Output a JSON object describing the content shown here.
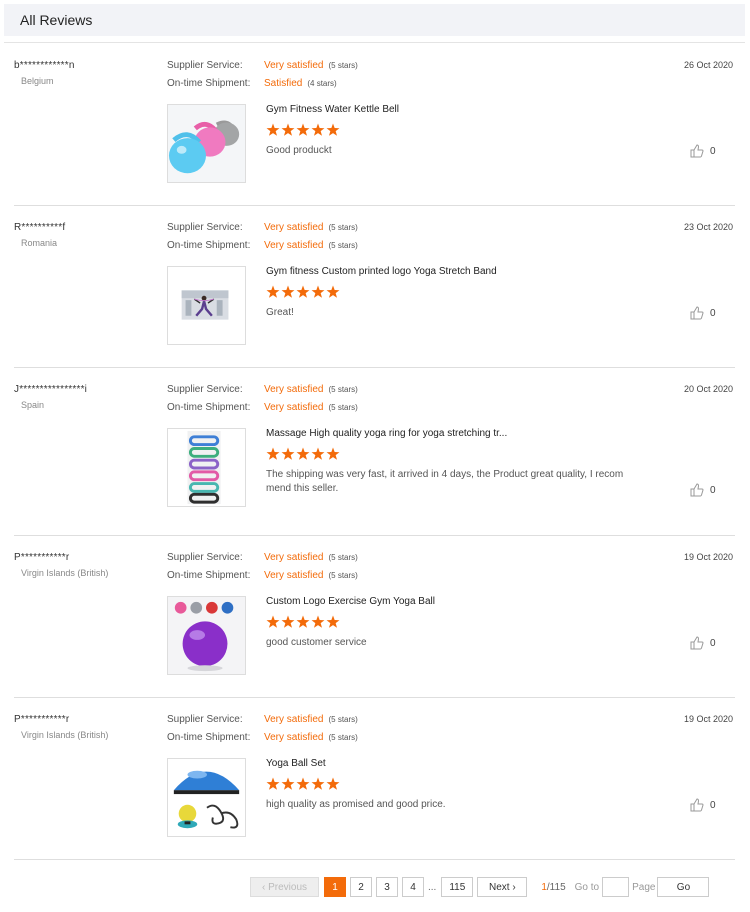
{
  "header": {
    "title": "All Reviews"
  },
  "labels": {
    "supplier_service": "Supplier Service:",
    "on_time_shipment": "On-time Shipment:"
  },
  "reviews": [
    {
      "reviewer": "b************n",
      "country": "Belgium",
      "date": "26 Oct 2020",
      "supplier_service": {
        "value": "Very satisfied",
        "stars": "(5 stars)"
      },
      "on_time_shipment": {
        "value": "Satisfied",
        "stars": "(4 stars)"
      },
      "product": "Gym Fitness Water Kettle Bell",
      "rating": 5,
      "comment": "Good produckt",
      "likes": "0",
      "image_icon": "kettlebell-product-image"
    },
    {
      "reviewer": "R**********f",
      "country": "Romania",
      "date": "23 Oct 2020",
      "supplier_service": {
        "value": "Very satisfied",
        "stars": "(5 stars)"
      },
      "on_time_shipment": {
        "value": "Very satisfied",
        "stars": "(5 stars)"
      },
      "product": "Gym fitness Custom printed logo Yoga Stretch Band",
      "rating": 5,
      "comment": "Great!",
      "likes": "0",
      "image_icon": "yoga-band-product-image"
    },
    {
      "reviewer": "J****************i",
      "country": "Spain",
      "date": "20 Oct 2020",
      "supplier_service": {
        "value": "Very satisfied",
        "stars": "(5 stars)"
      },
      "on_time_shipment": {
        "value": "Very satisfied",
        "stars": "(5 stars)"
      },
      "product": "Massage High quality yoga ring for yoga stretching tr...",
      "rating": 5,
      "comment": "The shipping was very fast, it arrived in 4 days, the Product great quality, I recom mend this seller.",
      "likes": "0",
      "image_icon": "yoga-ring-product-image"
    },
    {
      "reviewer": "P***********r",
      "country": "Virgin Islands (British)",
      "date": "19 Oct 2020",
      "supplier_service": {
        "value": "Very satisfied",
        "stars": "(5 stars)"
      },
      "on_time_shipment": {
        "value": "Very satisfied",
        "stars": "(5 stars)"
      },
      "product": "Custom Logo Exercise Gym Yoga Ball",
      "rating": 5,
      "comment": "good customer service",
      "likes": "0",
      "image_icon": "yoga-ball-product-image"
    },
    {
      "reviewer": "P***********r",
      "country": "Virgin Islands (British)",
      "date": "19 Oct 2020",
      "supplier_service": {
        "value": "Very satisfied",
        "stars": "(5 stars)"
      },
      "on_time_shipment": {
        "value": "Very satisfied",
        "stars": "(5 stars)"
      },
      "product": "Yoga Ball Set",
      "rating": 5,
      "comment": "high quality as promised and good price.",
      "likes": "0",
      "image_icon": "yoga-ball-set-product-image"
    }
  ],
  "pagination": {
    "previous": "Previous",
    "pages": [
      "1",
      "2",
      "3",
      "4"
    ],
    "ellipsis": "...",
    "last_page": "115",
    "next": "Next",
    "current": "1",
    "total": "/115",
    "goto_label": "Go to",
    "goto_value": "",
    "page_label": "Page",
    "go_button": "Go"
  },
  "colors": {
    "accent": "#f36b0a",
    "header_bg": "#f2f3f7"
  }
}
